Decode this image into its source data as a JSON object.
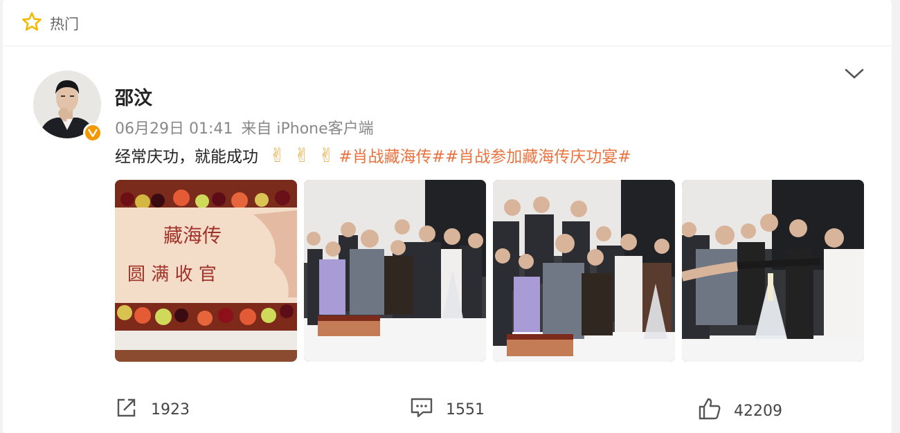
{
  "section": {
    "title": "热门",
    "icon": "star-outline-icon"
  },
  "post": {
    "author": "邵汶",
    "date_time": "06月29日 01:41",
    "source": "来自 iPhone客户端",
    "text": "经常庆功，就能成功",
    "emojis": [
      "✌",
      "✌",
      "✌"
    ],
    "hashtags": [
      "#肖战藏海传#",
      "#肖战参加藏海传庆功宴#"
    ],
    "cake_text_line1": "藏海传",
    "cake_text_line2": "圆 满 收 官",
    "photos": [
      "cake-closeup",
      "group-photo-cake",
      "group-photo-peace-sign",
      "champagne-tower-pour"
    ]
  },
  "actions": {
    "share_count": "1923",
    "comment_count": "1551",
    "like_count": "42209"
  },
  "colors": {
    "accent_orange": "#eb7340",
    "star_yellow": "#f5b800",
    "verified_badge": "#f39800"
  }
}
